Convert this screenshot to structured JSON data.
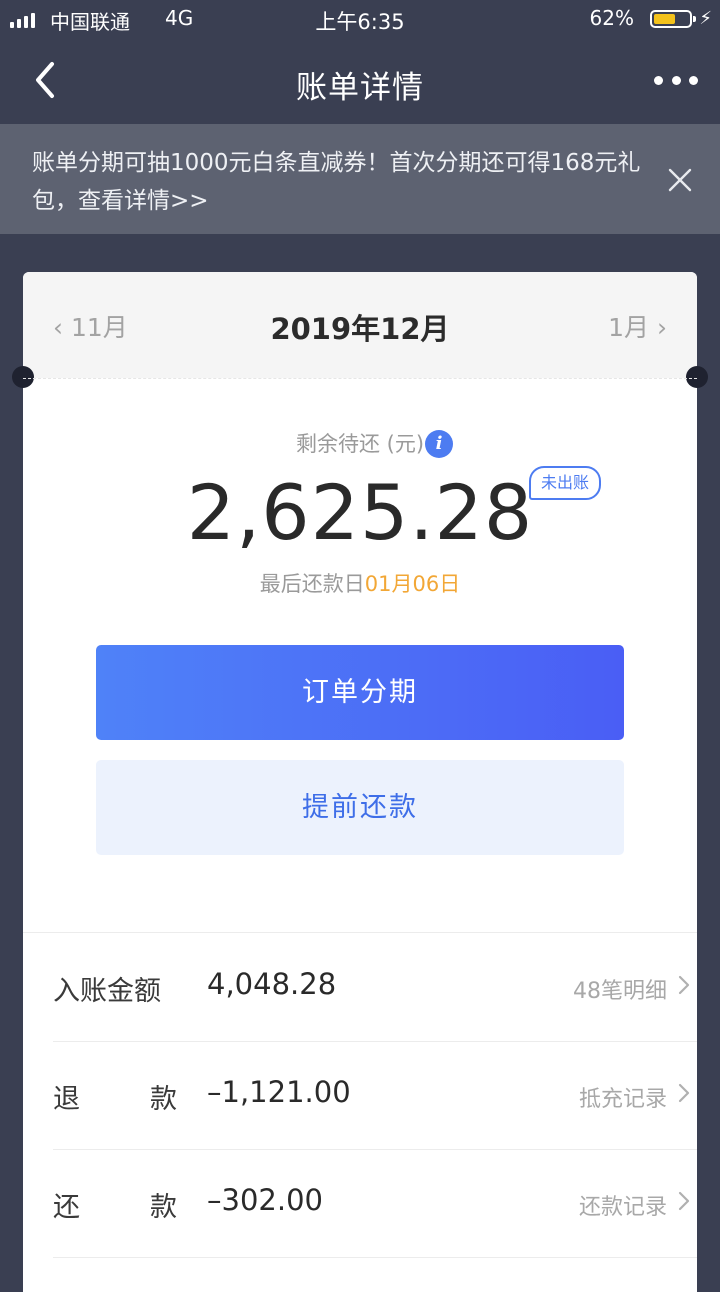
{
  "status_bar": {
    "carrier": "中国联通",
    "network": "4G",
    "time": "上午6:35",
    "battery_percent": "62%",
    "battery_level": 0.62
  },
  "nav": {
    "title": "账单详情",
    "back_icon": "chevron-left-icon",
    "more_icon": "more-dots-icon"
  },
  "banner": {
    "text": "账单分期可抽1000元白条直减券！首次分期还可得168元礼包，查看详情>>",
    "close_icon": "close-icon"
  },
  "month_nav": {
    "prev": "11月",
    "current": "2019年12月",
    "next": "1月"
  },
  "summary": {
    "remaining_label": "剩余待还 (元)",
    "info_icon": "info-icon",
    "info_glyph": "i",
    "amount": "2,625.28",
    "status_badge": "未出账",
    "due_label": "最后还款日",
    "due_date": "01月06日"
  },
  "buttons": {
    "installment": "订单分期",
    "prepay": "提前还款"
  },
  "rows": [
    {
      "k1": "入账金额",
      "value": "4,048.28",
      "link": "48笔明细"
    },
    {
      "k1": "退",
      "k2": "款",
      "value": "–1,121.00",
      "link": "抵充记录"
    },
    {
      "k1": "还",
      "k2": "款",
      "value": "–302.00",
      "link": "还款记录"
    }
  ],
  "colors": {
    "background": "#3a3f52",
    "accent": "#4d7cf1",
    "due_date": "#f2a736"
  }
}
